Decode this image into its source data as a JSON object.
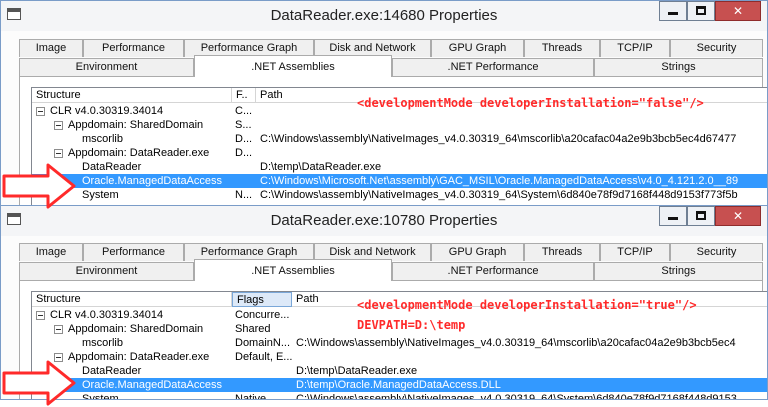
{
  "colors": {
    "accent_selection": "#3399ff",
    "annotation_red": "#ff2a2a",
    "close_button": "#c75050",
    "window_border": "#7a9cc8"
  },
  "window_top": {
    "title": "DataReader.exe:14680 Properties",
    "tabs_row1": [
      "Image",
      "Performance",
      "Performance Graph",
      "Disk and Network",
      "GPU Graph",
      "Threads",
      "TCP/IP",
      "Security"
    ],
    "tabs_row2": [
      "Environment",
      ".NET Assemblies",
      ".NET Performance",
      "Strings"
    ],
    "active_tab": ".NET Assemblies",
    "columns": [
      "Structure",
      "F..",
      "Path"
    ],
    "rows": [
      {
        "structure": "CLR v4.0.30319.34014",
        "flags": "C...",
        "path": "",
        "expander": true,
        "level": 0
      },
      {
        "structure": "Appdomain: SharedDomain",
        "flags": "S...",
        "path": "",
        "expander": true,
        "level": 1
      },
      {
        "structure": "mscorlib",
        "flags": "D...",
        "path": "C:\\Windows\\assembly\\NativeImages_v4.0.30319_64\\mscorlib\\a20cafac04a2e9b3bcb5ec4d67477",
        "expander": false,
        "level": 2
      },
      {
        "structure": "Appdomain: DataReader.exe",
        "flags": "D...",
        "path": "",
        "expander": true,
        "level": 1
      },
      {
        "structure": "DataReader",
        "flags": "",
        "path": "D:\\temp\\DataReader.exe",
        "expander": false,
        "level": 2
      },
      {
        "structure": "Oracle.ManagedDataAccess",
        "flags": "",
        "path": "C:\\Windows\\Microsoft.Net\\assembly\\GAC_MSIL\\Oracle.ManagedDataAccess\\v4.0_4.121.2.0__89",
        "expander": false,
        "level": 2,
        "selected": true
      },
      {
        "structure": "System",
        "flags": "N...",
        "path": "C:\\Windows\\assembly\\NativeImages_v4.0.30319_64\\System\\6d840e78f9d7168f448d9153f773f5b",
        "expander": false,
        "level": 2
      }
    ],
    "annotation_line1": "<developmentMode developerInstallation=\"false\"/>"
  },
  "window_bottom": {
    "title": "DataReader.exe:10780 Properties",
    "tabs_row1": [
      "Image",
      "Performance",
      "Performance Graph",
      "Disk and Network",
      "GPU Graph",
      "Threads",
      "TCP/IP",
      "Security"
    ],
    "tabs_row2": [
      "Environment",
      ".NET Assemblies",
      ".NET Performance",
      "Strings"
    ],
    "active_tab": ".NET Assemblies",
    "columns": [
      "Structure",
      "Flags",
      "Path"
    ],
    "sorted_column": "Flags",
    "rows": [
      {
        "structure": "CLR v4.0.30319.34014",
        "flags": "Concurre...",
        "path": "",
        "expander": true,
        "level": 0
      },
      {
        "structure": "Appdomain: SharedDomain",
        "flags": "Shared",
        "path": "",
        "expander": true,
        "level": 1
      },
      {
        "structure": "mscorlib",
        "flags": "DomainN...",
        "path": "C:\\Windows\\assembly\\NativeImages_v4.0.30319_64\\mscorlib\\a20cafac04a2e9b3bcb5ec4",
        "expander": false,
        "level": 2
      },
      {
        "structure": "Appdomain: DataReader.exe",
        "flags": "Default, E...",
        "path": "",
        "expander": true,
        "level": 1
      },
      {
        "structure": "DataReader",
        "flags": "",
        "path": "D:\\temp\\DataReader.exe",
        "expander": false,
        "level": 2
      },
      {
        "structure": "Oracle.ManagedDataAccess",
        "flags": "",
        "path": "D:\\temp\\Oracle.ManagedDataAccess.DLL",
        "expander": false,
        "level": 2,
        "selected": true
      },
      {
        "structure": "System",
        "flags": "Native",
        "path": "C:\\Windows\\assembly\\NativeImages_v4.0.30319_64\\System\\6d840e78f9d7168f448d9153",
        "expander": false,
        "level": 2
      }
    ],
    "annotation_line1": "<developmentMode developerInstallation=\"true\"/>",
    "annotation_line2": "DEVPATH=D:\\temp"
  }
}
